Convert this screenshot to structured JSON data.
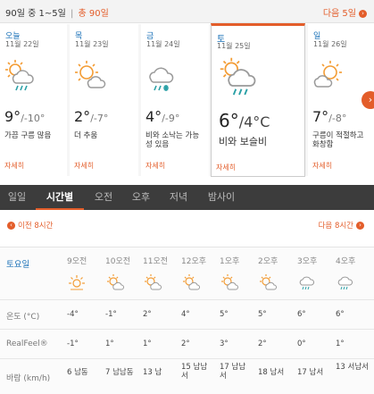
{
  "topbar": {
    "range_label": "90일 중 1~5일",
    "separator": "|",
    "all_label": "총 90일",
    "next_label": "다음 5일"
  },
  "days": [
    {
      "day": "오늘",
      "date": "11월 22일",
      "temp_hi": "9°",
      "temp_lo": "/-10°",
      "desc": [
        "가끔 구름 많음"
      ],
      "more": "자세히",
      "icon": "cloud-sun-rain-icon"
    },
    {
      "day": "목",
      "date": "11월 23일",
      "temp_hi": "2°",
      "temp_lo": "/-7°",
      "desc": [
        "더 추움"
      ],
      "more": "자세히",
      "icon": "sun-cloud-icon"
    },
    {
      "day": "금",
      "date": "11월 24일",
      "temp_hi": "4°",
      "temp_lo": "/-9°",
      "desc": [
        "비와 소낙는 가능",
        "성 있음"
      ],
      "more": "자세히",
      "icon": "cloud-sleet-icon"
    },
    {
      "day": "토",
      "date": "11월 25일",
      "temp_hi": "6°",
      "temp_lo": "/4°C",
      "desc": [
        "비와 보슬비"
      ],
      "more": "자세히",
      "icon": "cloud-sun-rain-icon"
    },
    {
      "day": "일",
      "date": "11월 26일",
      "temp_hi": "7°",
      "temp_lo": "/-8°",
      "desc": [
        "구름이 적절하고",
        "화창함"
      ],
      "more": "자세히",
      "icon": "sun-cloud-icon"
    }
  ],
  "tabs": [
    "일일",
    "시간별",
    "오전",
    "오후",
    "저녁",
    "밤사이"
  ],
  "hourly_nav": {
    "prev": "이전 8시간",
    "next": "다음 8시간"
  },
  "hourly": {
    "day_label": "토요일",
    "hours": [
      "9오전",
      "10오전",
      "11오전",
      "12오후",
      "1오후",
      "2오후",
      "3오후",
      "4오후"
    ],
    "icons": [
      "sun-icon",
      "sun-cloud-icon",
      "sun-cloud-icon",
      "sun-cloud-icon",
      "sun-cloud-icon",
      "sun-cloud-icon",
      "cloud-rain-icon",
      "cloud-rain-icon"
    ],
    "rows": [
      {
        "label": "온도 (°C)",
        "values": [
          "-4°",
          "-1°",
          "2°",
          "4°",
          "5°",
          "5°",
          "6°",
          "6°"
        ]
      },
      {
        "label": "RealFeel®",
        "values": [
          "-1°",
          "1°",
          "1°",
          "2°",
          "3°",
          "2°",
          "0°",
          "1°"
        ]
      },
      {
        "label": "바람 (km/h)",
        "values": [
          "6 남동",
          "7 남남동",
          "13 남",
          "15 남남서",
          "17 남남서",
          "18 남서",
          "17 남서",
          "13 서남서"
        ]
      }
    ]
  },
  "colors": {
    "accent": "#e35d2a",
    "link": "#1b72b8",
    "tabbar": "#3c3c3c",
    "sun": "#f39c34",
    "cloud": "#9a9a9a",
    "rain": "#2aa0a6"
  }
}
